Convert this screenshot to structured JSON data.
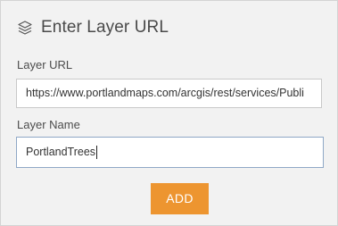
{
  "header": {
    "icon": "layers-icon",
    "title": "Enter Layer URL"
  },
  "form": {
    "url_label": "Layer URL",
    "url_value": "https://www.portlandmaps.com/arcgis/rest/services/Publi",
    "name_label": "Layer Name",
    "name_value": "PortlandTrees",
    "add_label": "ADD"
  },
  "colors": {
    "panel_background": "#f2f2f2",
    "accent_button": "#ed9530",
    "focused_border": "#8fa8c6"
  }
}
